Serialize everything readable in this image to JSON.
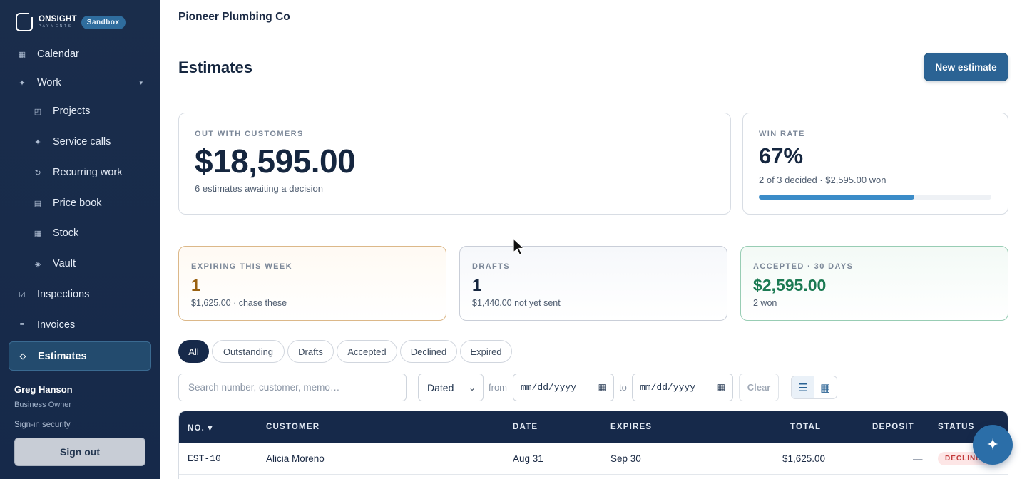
{
  "brand": {
    "name": "ONSIGHT",
    "sub": "PAYMENTS",
    "env_badge": "Sandbox"
  },
  "sidebar": {
    "items": [
      {
        "label": "Calendar",
        "icon": "calendar-icon"
      },
      {
        "label": "Work",
        "icon": "sparkle-icon",
        "expanded": true
      },
      {
        "label": "Projects",
        "icon": "projects-icon"
      },
      {
        "label": "Service calls",
        "icon": "sparkle-icon"
      },
      {
        "label": "Recurring work",
        "icon": "recurring-icon"
      },
      {
        "label": "Price book",
        "icon": "book-icon"
      },
      {
        "label": "Stock",
        "icon": "stock-icon"
      },
      {
        "label": "Vault",
        "icon": "vault-icon"
      },
      {
        "label": "Inspections",
        "icon": "checkbox-icon"
      },
      {
        "label": "Invoices",
        "icon": "list-icon"
      },
      {
        "label": "Estimates",
        "icon": "diamond-icon",
        "active": true
      }
    ],
    "user": {
      "name": "Greg Hanson",
      "role": "Business Owner"
    },
    "signin_security": "Sign-in security",
    "sign_out": "Sign out"
  },
  "header": {
    "company": "Pioneer Plumbing Co",
    "title": "Estimates",
    "new_button": "New estimate"
  },
  "summary": {
    "out": {
      "label": "OUT WITH CUSTOMERS",
      "amount": "$18,595.00",
      "sub": "6 estimates awaiting a decision"
    },
    "win": {
      "label": "WIN RATE",
      "value": "67%",
      "sub": "2 of 3 decided · $2,595.00 won",
      "progress": 0.67
    }
  },
  "mini_cards": {
    "expiring": {
      "label": "EXPIRING THIS WEEK",
      "value": "1",
      "sub": "$1,625.00 · chase these"
    },
    "drafts": {
      "label": "DRAFTS",
      "value": "1",
      "sub": "$1,440.00 not yet sent"
    },
    "accepted": {
      "label": "ACCEPTED · 30 DAYS",
      "value": "$2,595.00",
      "sub": "2 won"
    }
  },
  "filters": {
    "tabs": [
      "All",
      "Outstanding",
      "Drafts",
      "Accepted",
      "Declined",
      "Expired"
    ],
    "active": "All",
    "search_placeholder": "Search number, customer, memo…",
    "date_field": "Dated",
    "from_label": "from",
    "to_label": "to",
    "date_placeholder": "mm/dd/yyyy",
    "clear": "Clear"
  },
  "table": {
    "columns": [
      "NO. ▾",
      "CUSTOMER",
      "DATE",
      "EXPIRES",
      "TOTAL",
      "DEPOSIT",
      "STATUS"
    ],
    "rows": [
      {
        "no": "EST-10",
        "customer": "Alicia Moreno",
        "date": "Aug 31",
        "expires": "Sep 30",
        "total": "$1,625.00",
        "deposit": "—",
        "status": "DECLINED"
      }
    ]
  },
  "colors": {
    "sidebar_bg": "#1a2d4b",
    "accent": "#2b6394",
    "header_bg": "#16294a",
    "warning": "#9a6212",
    "success": "#1b7a52"
  }
}
